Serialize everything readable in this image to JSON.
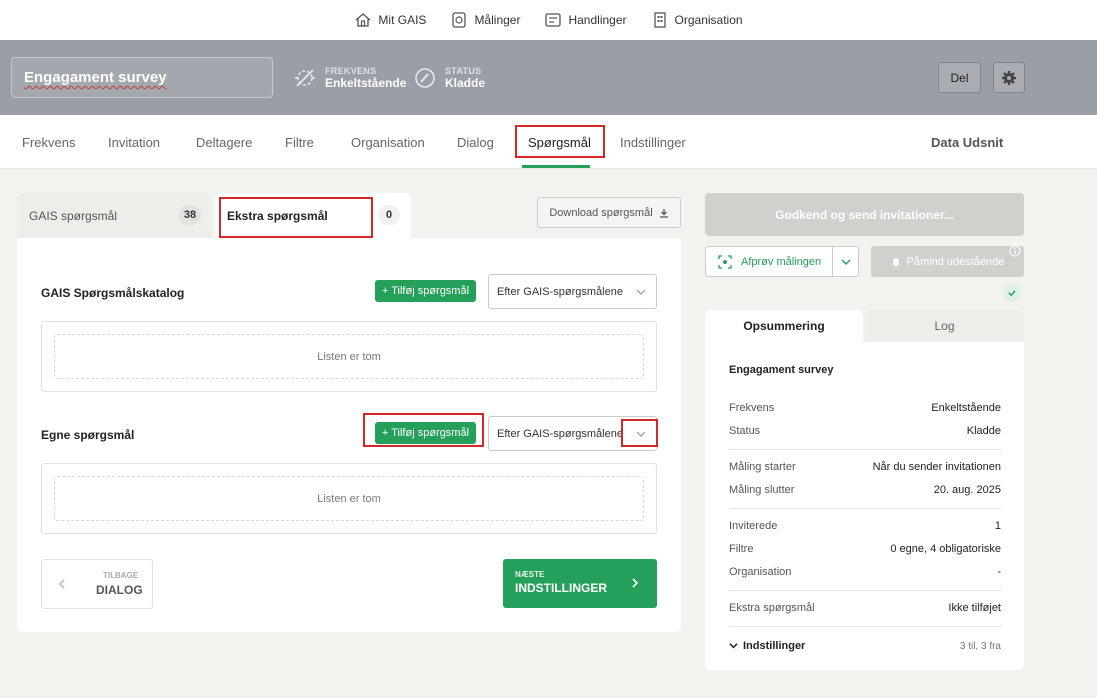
{
  "topnav": {
    "items": [
      {
        "label": "Mit GAIS",
        "icon": "home-icon"
      },
      {
        "label": "Målinger",
        "icon": "survey-icon"
      },
      {
        "label": "Handlinger",
        "icon": "actions-icon"
      },
      {
        "label": "Organisation",
        "icon": "building-icon"
      }
    ]
  },
  "header": {
    "title": "Engagament survey",
    "frequency_label": "FREKVENS",
    "frequency_value": "Enkeltstående",
    "status_label": "STATUS",
    "status_value": "Kladde",
    "share_label": "Del"
  },
  "tabs": [
    "Frekvens",
    "Invitation",
    "Deltagere",
    "Filtre",
    "Organisation",
    "Dialog",
    "Spørgsmål",
    "Indstillinger"
  ],
  "data_extract": "Data Udsnit",
  "subtabs": {
    "gais_label": "GAIS spørgsmål",
    "gais_count": "38",
    "extra_label": "Ekstra spørgsmål",
    "extra_count": "0"
  },
  "download_label": "Download spørgsmål",
  "sections": {
    "catalog_title": "GAIS Spørgsmålskatalog",
    "own_title": "Egne spørgsmål",
    "add_label": "+ Tilføj spørgsmål",
    "select_value": "Efter GAIS-spørgsmålene",
    "empty_label": "Listen er tom"
  },
  "nav_buttons": {
    "back_small": "TILBAGE",
    "back_big": "DIALOG",
    "next_small": "NÆSTE",
    "next_big": "INDSTILLINGER"
  },
  "right": {
    "send_label": "Godkend og send invitationer...",
    "try_label": "Afprøv målingen",
    "remind_label": "Påmind udestående",
    "tab_summary": "Opsummering",
    "tab_log": "Log",
    "summary_title": "Engagament survey",
    "rows": [
      {
        "k": "Frekvens",
        "v": "Enkeltstående"
      },
      {
        "k": "Status",
        "v": "Kladde"
      },
      {
        "k": "Måling starter",
        "v": "Når du sender invitationen"
      },
      {
        "k": "Måling slutter",
        "v": "20. aug. 2025"
      },
      {
        "k": "Inviterede",
        "v": "1"
      },
      {
        "k": "Filtre",
        "v": "0 egne, 4 obligatoriske"
      },
      {
        "k": "Organisation",
        "v": "-"
      },
      {
        "k": "Ekstra spørgsmål",
        "v": "Ikke tilføjet"
      }
    ],
    "settings_label": "Indstillinger",
    "settings_value": "3 til, 3 fra"
  },
  "colors": {
    "accent": "#24a05a",
    "highlight": "#d62828",
    "header_bg": "#9a9ea6"
  }
}
